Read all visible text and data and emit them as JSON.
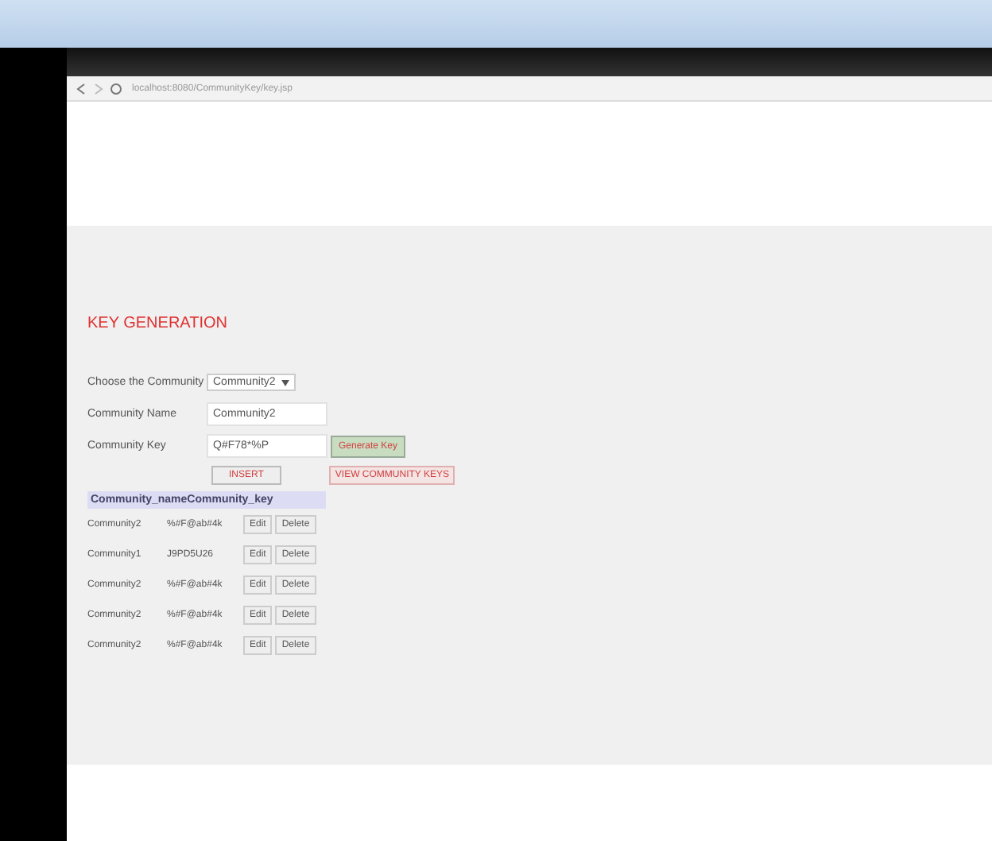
{
  "browser": {
    "address": "localhost:8080/CommunityKey/key.jsp"
  },
  "heading": "KEY GENERATION",
  "form": {
    "fields": [
      {
        "kind": "select",
        "label": "Choose the Community",
        "value": "Community2"
      },
      {
        "kind": "text",
        "label": "Community Name",
        "value": "Community2"
      },
      {
        "kind": "text",
        "label": "Community Key",
        "value": "Q#F78*%P"
      }
    ],
    "generate_button": "Generate Key",
    "insert_button": "INSERT",
    "view_button": "VIEW COMMUNITY KEYS"
  },
  "table": {
    "header": "Community_nameCommunity_key",
    "rows": [
      {
        "name": "Community2",
        "key": "%#F@ab#4k",
        "edit": "Edit",
        "delete": "Delete"
      },
      {
        "name": "Community1",
        "key": "J9PD5U26",
        "edit": "Edit",
        "delete": "Delete"
      },
      {
        "name": "Community2",
        "key": "%#F@ab#4k",
        "edit": "Edit",
        "delete": "Delete"
      },
      {
        "name": "Community2",
        "key": "%#F@ab#4k",
        "edit": "Edit",
        "delete": "Delete"
      },
      {
        "name": "Community2",
        "key": "%#F@ab#4k",
        "edit": "Edit",
        "delete": "Delete"
      }
    ]
  }
}
